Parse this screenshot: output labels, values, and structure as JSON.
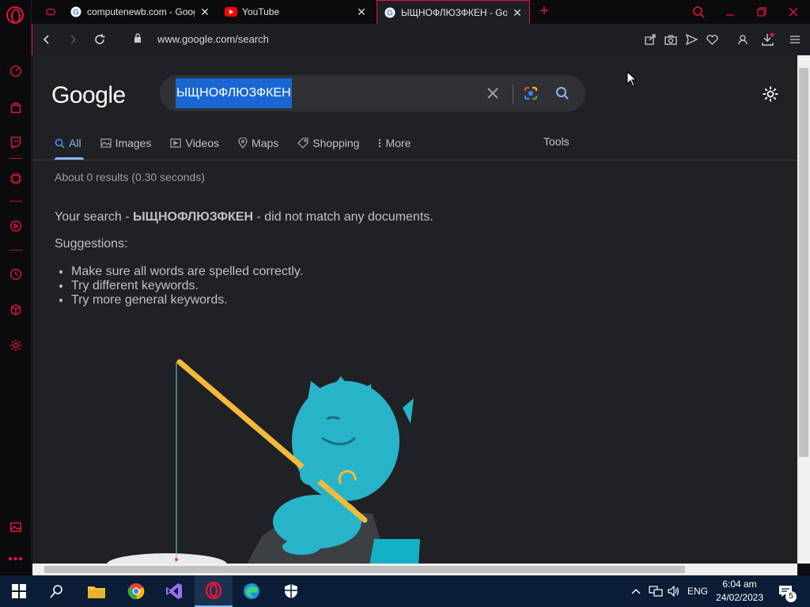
{
  "browser": {
    "tabs": [
      {
        "title": "computenewb.com - Goog",
        "favicon": "google-icon",
        "active": false
      },
      {
        "title": "YouTube",
        "favicon": "youtube-icon",
        "active": false
      },
      {
        "title": "ЫЩНОФЛЮЗФКЕН - Goog",
        "favicon": "google-icon",
        "active": true
      }
    ],
    "url": "www.google.com/search",
    "accent": "#e0163c"
  },
  "google": {
    "logo": "Google",
    "query": "ЫЩНОФЛЮЗФКЕН",
    "tabs": [
      {
        "label": "All",
        "icon": "search-icon"
      },
      {
        "label": "Images",
        "icon": "image-icon"
      },
      {
        "label": "Videos",
        "icon": "play-icon"
      },
      {
        "label": "Maps",
        "icon": "map-pin-icon"
      },
      {
        "label": "Shopping",
        "icon": "tag-icon"
      },
      {
        "label": "More",
        "icon": "more-vert-icon"
      }
    ],
    "tools_label": "Tools",
    "stats": "About 0 results (0.30 seconds)",
    "nomatch_prefix": "Your search - ",
    "nomatch_query": "ЫЩНОФЛЮЗФКЕН",
    "nomatch_suffix": " - did not match any documents.",
    "suggestions_heading": "Suggestions:",
    "suggestions": [
      "Make sure all words are spelled correctly.",
      "Try different keywords.",
      "Try more general keywords."
    ],
    "accent": "#8ab4f8"
  },
  "taskbar": {
    "language": "ENG",
    "time": "6:04 am",
    "date": "24/02/2023",
    "notifications": "5"
  }
}
